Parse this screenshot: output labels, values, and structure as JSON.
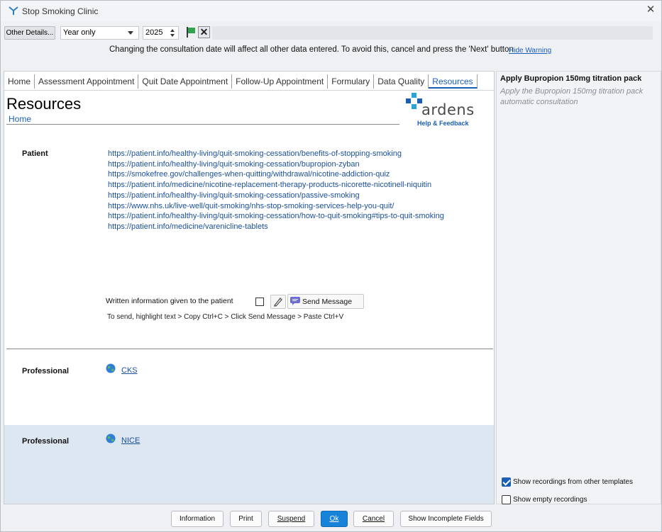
{
  "window": {
    "title": "Stop Smoking Clinic",
    "close_icon": "close-icon"
  },
  "toolbar": {
    "other_details_label": "Other Details...",
    "date_mode_value": "Year only",
    "year_value": "2025",
    "flag_icon": "green-flag-icon",
    "clear_icon": "clear-x-icon"
  },
  "warning": {
    "text": "Changing the consultation date will affect all other data entered. To avoid this, cancel and press the 'Next' button",
    "hide_label": "Hide Warning"
  },
  "tabs": [
    {
      "label": "Home"
    },
    {
      "label": "Assessment Appointment"
    },
    {
      "label": "Quit Date Appointment"
    },
    {
      "label": "Follow-Up Appointment"
    },
    {
      "label": "Formulary"
    },
    {
      "label": "Data Quality"
    },
    {
      "label": "Resources",
      "active": true
    }
  ],
  "page": {
    "title": "Resources",
    "home_link": "Home",
    "logo_word": "ardens",
    "logo_help": "Help & Feedback"
  },
  "patient": {
    "label": "Patient",
    "links": [
      "https://patient.info/healthy-living/quit-smoking-cessation/benefits-of-stopping-smoking",
      "https://patient.info/healthy-living/quit-smoking-cessation/bupropion-zyban",
      "https://smokefree.gov/challenges-when-quitting/withdrawal/nicotine-addiction-quiz",
      "https://patient.info/medicine/nicotine-replacement-therapy-products-nicorette-nicotinell-niquitin",
      "https://patient.info/healthy-living/quit-smoking-cessation/passive-smoking",
      "https://www.nhs.uk/live-well/quit-smoking/nhs-stop-smoking-services-help-you-quit/",
      "https://patient.info/healthy-living/quit-smoking-cessation/how-to-quit-smoking#tips-to-quit-smoking",
      "https://patient.info/medicine/varenicline-tablets"
    ],
    "written_info_label": "Written information given to the patient",
    "written_info_checked": false,
    "send_message_label": "Send Message",
    "send_hint": "To send, highlight text > Copy Ctrl+C > Click Send Message > Paste Ctrl+V"
  },
  "professional": [
    {
      "label": "Professional",
      "link": "CKS"
    },
    {
      "label": "Professional",
      "link": "NICE"
    }
  ],
  "side": {
    "title": "Apply Bupropion 150mg titration pack",
    "description": "Apply the Bupropion 150mg titration pack automatic consultation",
    "show_other_label": "Show recordings from other templates",
    "show_other_checked": true,
    "show_empty_label": "Show empty recordings",
    "show_empty_checked": false
  },
  "buttons": {
    "information": "Information",
    "print": "Print",
    "suspend": "Suspend",
    "ok": "Ok",
    "cancel": "Cancel",
    "show_incomplete": "Show Incomplete Fields"
  },
  "colors": {
    "accent": "#1a5fb4",
    "ok_button": "#1683d8",
    "highlight_band": "#dde7f2"
  }
}
